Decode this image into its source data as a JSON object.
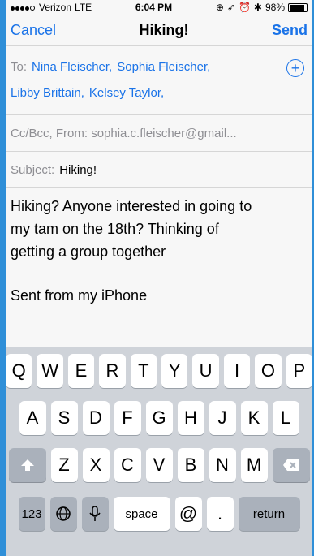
{
  "status": {
    "carrier": "Verizon",
    "network": "LTE",
    "time": "6:04 PM",
    "battery": "98%"
  },
  "nav": {
    "cancel": "Cancel",
    "title": "Hiking!",
    "send": "Send"
  },
  "to": {
    "label": "To:",
    "recipients": [
      "Nina Fleischer,",
      "Sophia Fleischer,",
      "Libby Brittain,",
      "Kelsey Taylor,"
    ]
  },
  "cc": {
    "label": "Cc/Bcc, From:",
    "from": "sophia.c.fleischer@gmail..."
  },
  "subject": {
    "label": "Subject:",
    "value": "Hiking!"
  },
  "body": {
    "line1": "Hiking? Anyone interested in going to",
    "line2": "my tam on the 18th? Thinking of",
    "line3": "getting a group together",
    "signature": "Sent from my iPhone"
  },
  "keyboard": {
    "row1": [
      "Q",
      "W",
      "E",
      "R",
      "T",
      "Y",
      "U",
      "I",
      "O",
      "P"
    ],
    "row2": [
      "A",
      "S",
      "D",
      "F",
      "G",
      "H",
      "J",
      "K",
      "L"
    ],
    "row3": [
      "Z",
      "X",
      "C",
      "V",
      "B",
      "N",
      "M"
    ],
    "numbers": "123",
    "space": "space",
    "at": "@",
    "dot": ".",
    "return": "return"
  }
}
